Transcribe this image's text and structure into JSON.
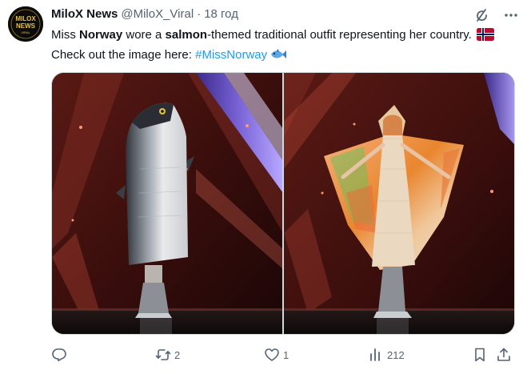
{
  "tweet": {
    "author_name": "MiloX News",
    "handle": "@MiloX_Viral",
    "separator": "·",
    "time": "18 год",
    "text": {
      "p1": "Miss ",
      "b1": "Norway",
      "p2": " wore a ",
      "b2": "salmon",
      "p3": "-themed traditional outfit representing her country. ",
      "p4": " Check out the image here:  ",
      "hashtag": "#MissNorway"
    },
    "avatar": {
      "l1": "MILOX",
      "l2": "NEWS",
      "l3": "VIRAL"
    }
  },
  "actions": {
    "reply_count": "",
    "retweet_count": "2",
    "like_count": "1",
    "views_count": "212"
  },
  "icons": [
    "grok-icon",
    "more-icon",
    "reply-icon",
    "retweet-icon",
    "like-icon",
    "views-icon",
    "bookmark-icon",
    "share-icon",
    "norway-flag-icon",
    "fish-emoji-icon"
  ],
  "colors": {
    "link": "#1d9bf0",
    "muted": "#536471",
    "text": "#0f1419",
    "border": "#cfd9de"
  }
}
